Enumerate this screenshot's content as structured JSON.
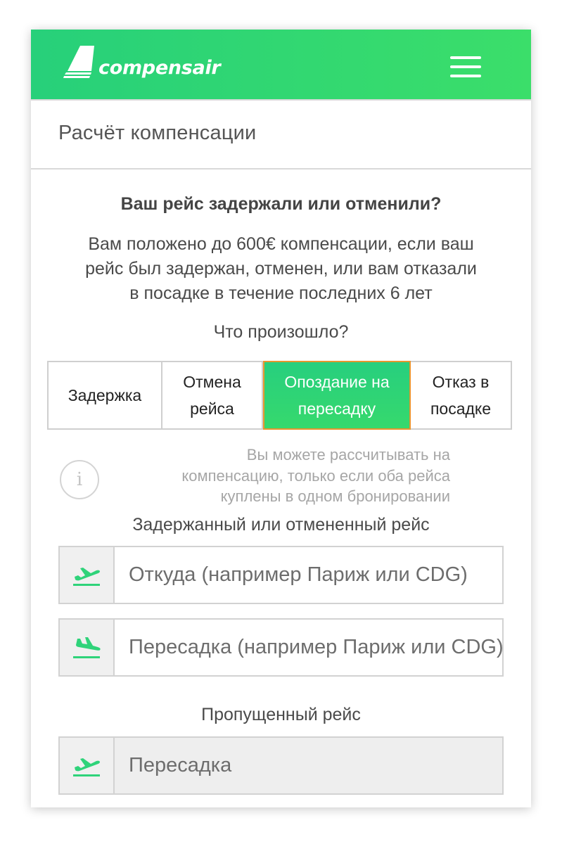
{
  "header": {
    "logo_text": "compensair",
    "brand_color": "#2fd672"
  },
  "page": {
    "title": "Расчёт компенсации",
    "question": "Ваш рейс задержали или отменили?",
    "info_line_1": "Вам положено до 600€ компенсации, если ваш",
    "info_line_2": "рейс был задержан, отменен, или вам отказали",
    "info_line_3": "в посадке в течение последних 6 лет",
    "what_happened": "Что произошло?"
  },
  "options": [
    {
      "line1": "Задержка",
      "line2": "",
      "selected": false
    },
    {
      "line1": "Отмена",
      "line2": "рейса",
      "selected": false
    },
    {
      "line1": "Опоздание на",
      "line2": "пересадку",
      "selected": true
    },
    {
      "line1": "Отказ в",
      "line2": "посадке",
      "selected": false
    }
  ],
  "notice": {
    "icon": "info-icon",
    "icon_glyph": "i",
    "line1": "Вы можете рассчитывать на",
    "line2": "компенсацию, только если оба рейса",
    "line3": "куплены в одном бронировании"
  },
  "delayed_section": {
    "label": "Задержанный или отмененный рейс",
    "from_placeholder": "Откуда (например Париж или CDG)",
    "connection_placeholder": "Пересадка (например Париж или CDG)"
  },
  "missed_section": {
    "label": "Пропущенный рейс",
    "placeholder": "Пересадка"
  }
}
